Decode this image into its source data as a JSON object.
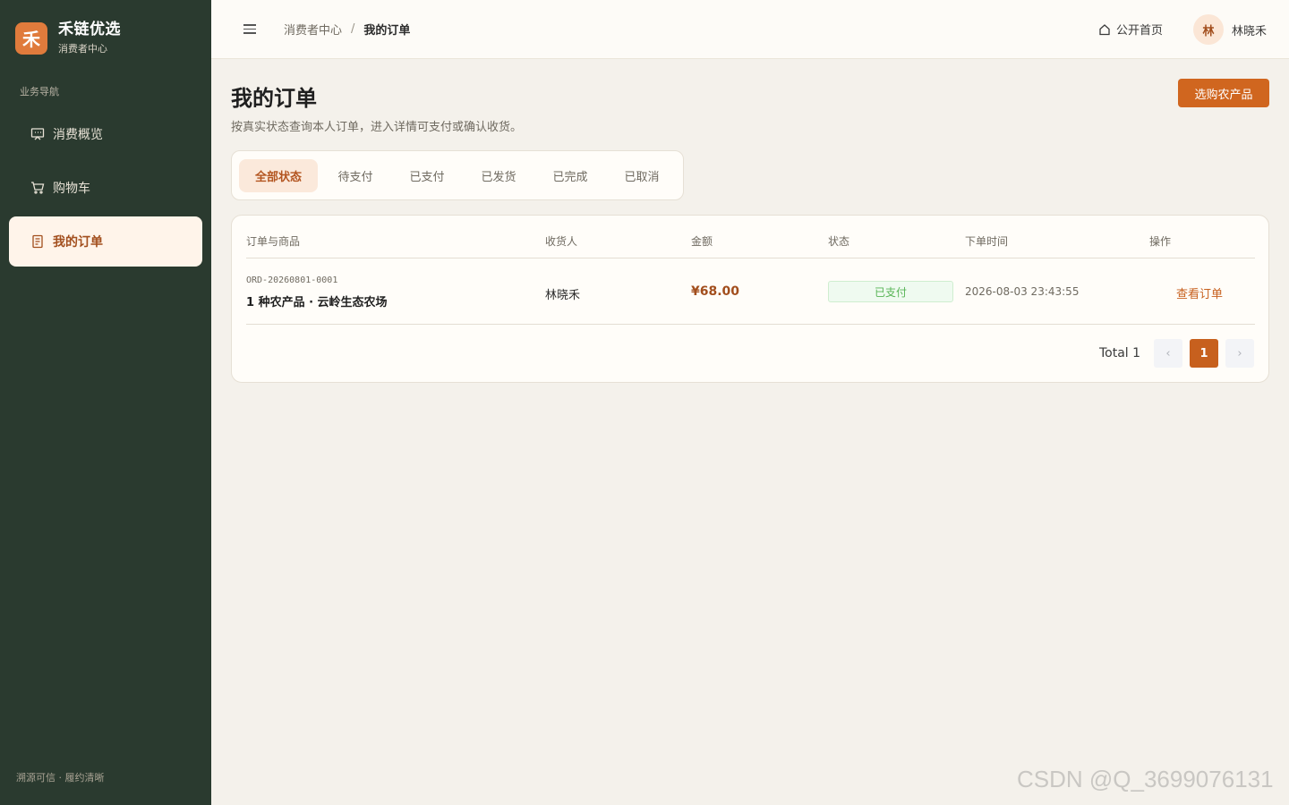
{
  "brand": {
    "logo_char": "禾",
    "name": "禾链优选",
    "subtitle": "消费者中心"
  },
  "sidebar": {
    "section_label": "业务导航",
    "items": [
      {
        "label": "消费概览",
        "icon": "presentation-icon"
      },
      {
        "label": "购物车",
        "icon": "cart-icon"
      },
      {
        "label": "我的订单",
        "icon": "document-icon",
        "active": true
      }
    ],
    "footer": "溯源可信 · 履约清晰"
  },
  "header": {
    "breadcrumb": [
      "消费者中心",
      "我的订单"
    ],
    "breadcrumb_sep": "/",
    "home_link": "公开首页",
    "avatar_char": "林",
    "user_name": "林晓禾"
  },
  "main": {
    "title": "我的订单",
    "description": "按真实状态查询本人订单，进入详情可支付或确认收货。",
    "primary_button": "选购农产品",
    "tabs": [
      "全部状态",
      "待支付",
      "已支付",
      "已发货",
      "已完成",
      "已取消"
    ],
    "active_tab": 0,
    "table": {
      "headers": [
        "订单与商品",
        "收货人",
        "金额",
        "状态",
        "下单时间",
        "操作"
      ],
      "rows": [
        {
          "order_no": "ORD-20260801-0001",
          "product": "1 种农产品 · 云岭生态农场",
          "receiver": "林晓禾",
          "amount": "¥68.00",
          "status": "已支付",
          "time": "2026-08-03 23:43:55",
          "action": "查看订单"
        }
      ]
    },
    "pagination": {
      "total_label": "Total 1",
      "current_page": "1",
      "prev": "‹",
      "next": "›"
    }
  },
  "colors": {
    "sidebar_bg": "#2a3a2f",
    "accent": "#d0661f",
    "page_bg": "#f4f1eb",
    "status_paid": "#57b455"
  },
  "watermark": "CSDN @Q_3699076131"
}
